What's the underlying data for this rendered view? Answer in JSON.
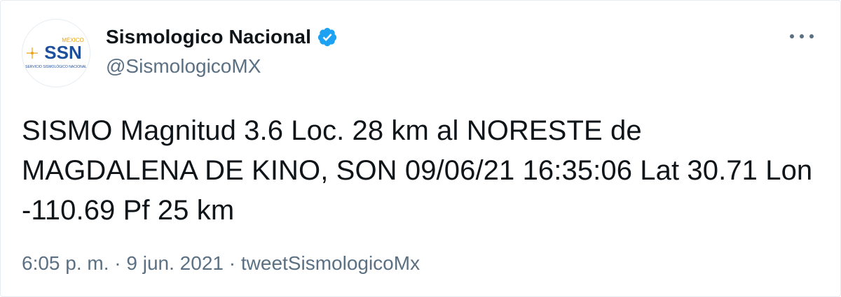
{
  "account": {
    "display_name": "Sismologico Nacional",
    "handle": "@SismologicoMX",
    "verified_icon": "verified-badge-icon",
    "avatar_logo": {
      "country": "MÉXICO",
      "acronym": "SSN",
      "subtitle": "SERVICIO SISMOLÓGICO NACIONAL"
    }
  },
  "tweet": {
    "text": "SISMO Magnitud 3.6 Loc. 28 km al NORESTE de MAGDALENA DE KINO, SON 09/06/21 16:35:06 Lat 30.71 Lon -110.69 Pf 25 km"
  },
  "meta": {
    "time": "6:05 p. m.",
    "separator": " · ",
    "date": "9 jun. 2021",
    "source": "tweetSismologicoMx"
  },
  "icons": {
    "more": "more-options-icon"
  },
  "colors": {
    "text": "#0f1419",
    "secondary": "#5b7083",
    "verified": "#1da1f2",
    "logo_blue": "#1d4f9c",
    "logo_gold": "#e8a317"
  }
}
